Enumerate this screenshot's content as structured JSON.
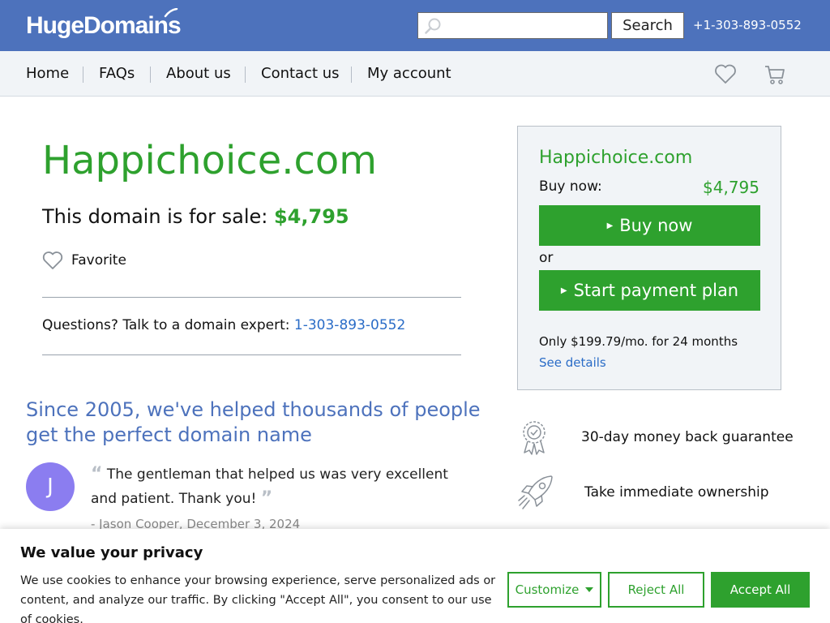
{
  "header": {
    "logo_text": "HugeDomains",
    "search": {
      "value": "",
      "placeholder": "",
      "button_label": "Search"
    },
    "phone": "+1-303-893-0552"
  },
  "nav": {
    "items": [
      {
        "label": "Home"
      },
      {
        "label": "FAQs"
      },
      {
        "label": "About us"
      },
      {
        "label": "Contact us"
      },
      {
        "label": "My account"
      }
    ],
    "icons": [
      "heart-icon",
      "cart-icon"
    ]
  },
  "main": {
    "domain": "Happichoice.com",
    "for_sale_text": "This domain is for sale: ",
    "price": "$4,795",
    "favorite_label": "Favorite",
    "questions_text": "Questions? Talk to a domain expert: ",
    "questions_phone": "1-303-893-0552",
    "since_heading": "Since 2005, we've helped thousands of people get the perfect domain name",
    "testimonial": {
      "avatar_letter": "J",
      "quote": "The gentleman that helped us was very excellent and patient. Thank you!",
      "author": "- Jason Cooper, December 3, 2024"
    }
  },
  "card": {
    "domain": "Happichoice.com",
    "buy_now_label": "Buy now:",
    "price": "$4,795",
    "buy_button": "Buy now",
    "or_text": "or",
    "payment_button": "Start payment plan",
    "monthly_text": "Only $199.79/mo. for 24 months",
    "details_link": "See details"
  },
  "features": [
    {
      "icon": "award-ribbon-icon",
      "text": "30-day money back guarantee"
    },
    {
      "icon": "rocket-icon",
      "text": "Take immediate ownership"
    }
  ],
  "cookie": {
    "title": "We value your privacy",
    "text": "We use cookies to enhance your browsing experience, serve personalized ads or content, and analyze our traffic. By clicking \"Accept All\", you consent to our use of cookies.",
    "customize": "Customize",
    "reject": "Reject All",
    "accept": "Accept All"
  },
  "colors": {
    "header_blue": "#4d72bc",
    "brand_green": "#2ea12e",
    "link_blue": "#2a6cc7",
    "nav_bg": "#f1f4f7",
    "avatar_purple": "#8b7df0"
  }
}
